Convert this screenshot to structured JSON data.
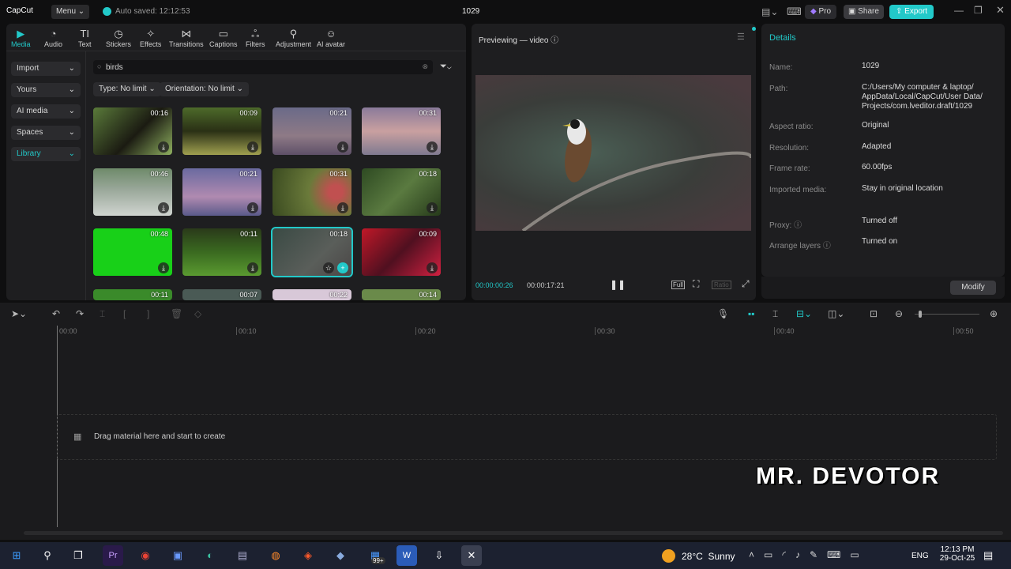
{
  "app": {
    "logo": "CapCut",
    "menu": "Menu",
    "autosave": "Auto saved: 12:12:53",
    "project_title": "1029",
    "pro": "Pro",
    "share": "Share",
    "export": "Export"
  },
  "tabs": [
    {
      "label": "Media",
      "icon": "▶"
    },
    {
      "label": "Audio",
      "icon": "◔"
    },
    {
      "label": "Text",
      "icon": "TI"
    },
    {
      "label": "Stickers",
      "icon": "◷"
    },
    {
      "label": "Effects",
      "icon": "✧"
    },
    {
      "label": "Transitions",
      "icon": "⋈"
    },
    {
      "label": "Captions",
      "icon": "▭"
    },
    {
      "label": "Filters",
      "icon": "ஃ"
    },
    {
      "label": "Adjustment",
      "icon": "⚲"
    },
    {
      "label": "AI avatar",
      "icon": "☺"
    }
  ],
  "sidebar": [
    {
      "label": "Import"
    },
    {
      "label": "Yours"
    },
    {
      "label": "AI media"
    },
    {
      "label": "Spaces"
    },
    {
      "label": "Library"
    }
  ],
  "search": {
    "value": "birds"
  },
  "filters": {
    "type": "Type: No limit",
    "orientation": "Orientation: No limit"
  },
  "media": [
    {
      "duration": "00:16",
      "bg": "linear-gradient(135deg,#5a7a3a,#1b1b12 55%,#8fb060)"
    },
    {
      "duration": "00:09",
      "bg": "linear-gradient(180deg,#4d6a2a,#2a3015 50%,#a0a050)"
    },
    {
      "duration": "00:21",
      "bg": "linear-gradient(180deg,#6a6a88,#8e7a86 60%,#5e5068)"
    },
    {
      "duration": "00:31",
      "bg": "linear-gradient(180deg,#8a7a9a,#c9a0a0 50%,#7f7a90)"
    },
    {
      "duration": "00:46",
      "bg": "linear-gradient(180deg,#6e8a6a,#9aa89a 45%,#d0d4d0)"
    },
    {
      "duration": "00:21",
      "bg": "linear-gradient(180deg,#6a6aa0,#b08ab0 60%,#5a5a8a)"
    },
    {
      "duration": "00:31",
      "bg": "radial-gradient(circle at 80% 50%,#c05050 10%,#6a7a3a 40%,#3a4a20)"
    },
    {
      "duration": "00:18",
      "bg": "linear-gradient(135deg,#2e4a22,#5a7a40 50%,#263a1a)"
    },
    {
      "duration": "00:48",
      "bg": "#18d018"
    },
    {
      "duration": "00:11",
      "bg": "linear-gradient(180deg,#2a3a1a,#3a6a20 50%,#5a9a30)"
    },
    {
      "duration": "00:18",
      "bg": "linear-gradient(135deg,#3a4a44,#5a5e5a 60%,#4a4646)"
    },
    {
      "duration": "00:09",
      "bg": "linear-gradient(135deg,#c01828,#501020 50%,#d02040)"
    },
    {
      "duration": "00:11",
      "bg": "#3a8a2a"
    },
    {
      "duration": "00:07",
      "bg": "#4a5a55"
    },
    {
      "duration": "00:22",
      "bg": "#d8c8d8"
    },
    {
      "duration": "00:14",
      "bg": "#6a8a4a"
    }
  ],
  "preview": {
    "title": "Previewing — video",
    "current": "00:00:00:26",
    "total": "00:00:17:21",
    "full": "Full",
    "ratio": "Ratio"
  },
  "details": {
    "title": "Details",
    "rows": [
      {
        "label": "Name:",
        "value": "1029"
      },
      {
        "label": "Path:",
        "value": "C:/Users/My computer & laptop/ AppData/Local/CapCut/User Data/ Projects/com.lveditor.draft/1029"
      },
      {
        "label": "Aspect ratio:",
        "value": "Original"
      },
      {
        "label": "Resolution:",
        "value": "Adapted"
      },
      {
        "label": "Frame rate:",
        "value": "60.00fps"
      },
      {
        "label": "Imported media:",
        "value": "Stay in original location"
      },
      {
        "label": "Proxy:",
        "value": "Turned off"
      },
      {
        "label": "Arrange layers",
        "value": "Turned on"
      }
    ],
    "modify": "Modify"
  },
  "timeline": {
    "ticks": [
      "00:00",
      "00:10",
      "00:20",
      "00:30",
      "00:40",
      "00:50"
    ],
    "drop_hint": "Drag material here and start to create"
  },
  "watermark": "MR. DEVOTOR",
  "taskbar": {
    "weather": "28°C  Sunny",
    "lang": "ENG",
    "time": "12:13 PM",
    "date": "29-Oct-25",
    "badge": "99+"
  }
}
